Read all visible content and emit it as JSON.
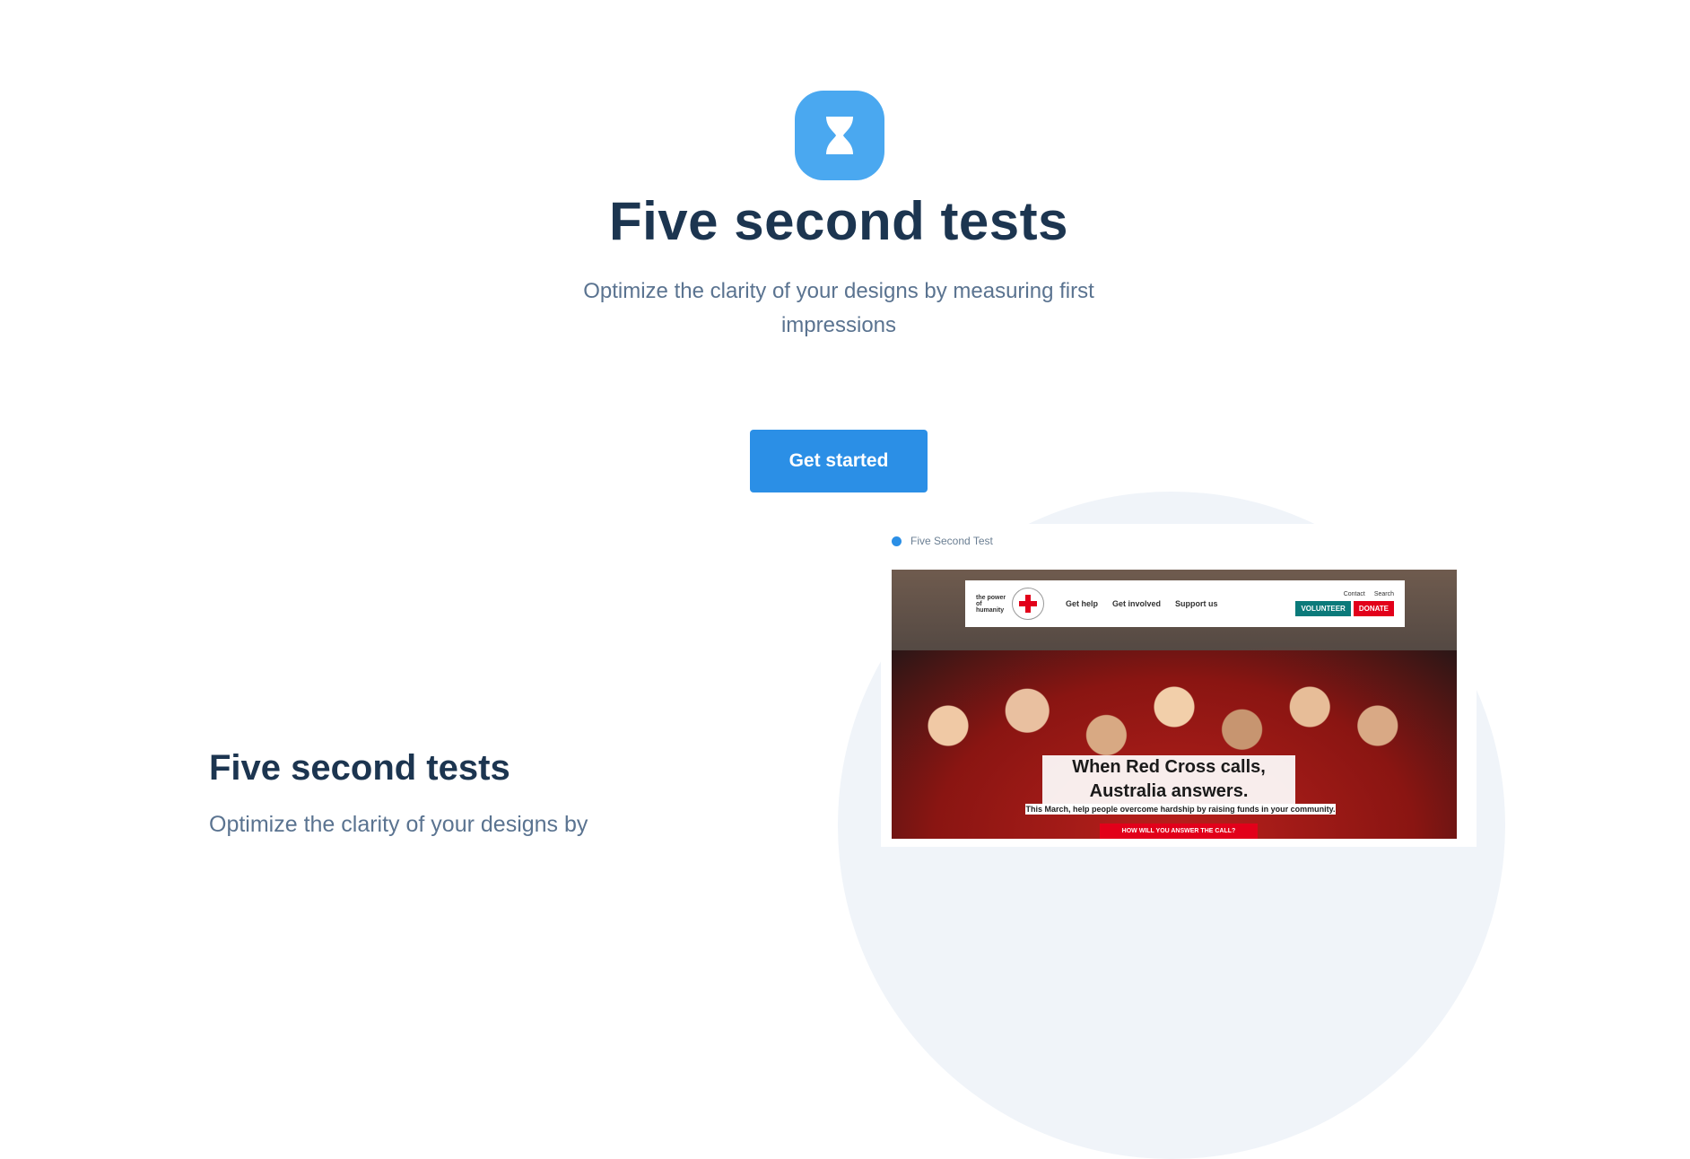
{
  "hero": {
    "icon": "hourglass-icon",
    "title": "Five second tests",
    "subtitle": "Optimize the clarity of your designs by measuring first impressions",
    "cta_label": "Get started"
  },
  "preview": {
    "label": "Five Second Test",
    "screenshot": {
      "brand": "the power of humanity",
      "nav_links": [
        "Get help",
        "Get involved",
        "Support us"
      ],
      "top_links": [
        "Contact",
        "Search"
      ],
      "volunteer": "VOLUNTEER",
      "donate": "DONATE",
      "headline": "When Red Cross calls, Australia answers.",
      "subline": "This March, help people overcome hardship by raising funds in your community.",
      "answer": "HOW WILL YOU ANSWER THE CALL?"
    }
  },
  "section": {
    "title": "Five second tests",
    "text": "Optimize the clarity of your designs by"
  },
  "colors": {
    "accent": "#2b8fe6",
    "icon_bg": "#4aa8f0",
    "heading": "#1c3550",
    "body_text": "#5a7390"
  }
}
